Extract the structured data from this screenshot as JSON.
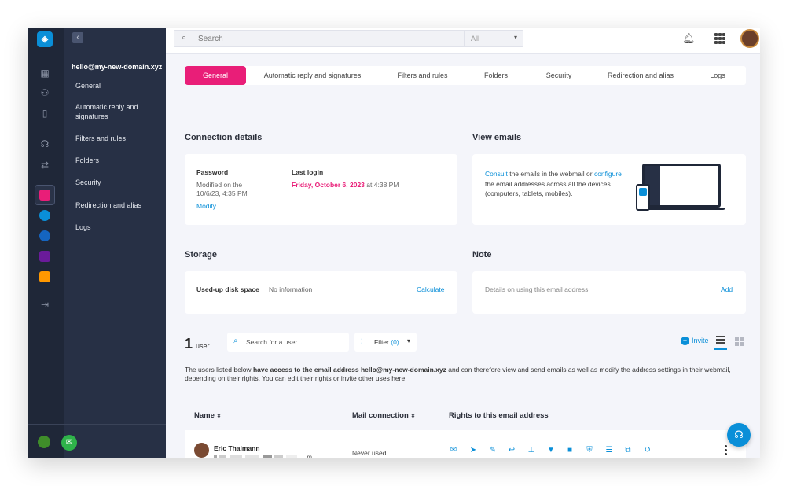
{
  "sidebar": {
    "account": "hello@my-new-domain.xyz",
    "items": [
      {
        "label": "General"
      },
      {
        "label": "Automatic reply and signatures"
      },
      {
        "label": "Filters and rules"
      },
      {
        "label": "Folders"
      },
      {
        "label": "Security"
      },
      {
        "label": "Redirection and alias"
      },
      {
        "label": "Logs"
      }
    ]
  },
  "topbar": {
    "search_placeholder": "Search",
    "scope_value": "All"
  },
  "tabs": [
    {
      "label": "General"
    },
    {
      "label": "Automatic reply and signatures"
    },
    {
      "label": "Filters and rules"
    },
    {
      "label": "Folders"
    },
    {
      "label": "Security"
    },
    {
      "label": "Redirection and alias"
    },
    {
      "label": "Logs"
    }
  ],
  "connection": {
    "title": "Connection details",
    "password_label": "Password",
    "modified_text": "Modified on the 10/6/23, 4:35 PM",
    "modify_link": "Modify",
    "last_login_label": "Last login",
    "last_login_date": "Friday, October 6, 2023",
    "last_login_time": "at 4:38 PM"
  },
  "view_emails": {
    "title": "View emails",
    "consult": "Consult",
    "text1": "the emails in the webmail or",
    "configure": "configure",
    "text2": "the email addresses across all the devices (computers, tablets, mobiles)."
  },
  "storage": {
    "title": "Storage",
    "label": "Used-up disk space",
    "value": "No information",
    "action": "Calculate"
  },
  "note": {
    "title": "Note",
    "placeholder": "Details on using this email address",
    "action": "Add"
  },
  "users": {
    "count": "1",
    "word": "user",
    "search_placeholder": "Search for a user",
    "filter_label": "Filter",
    "filter_count": "(0)",
    "invite": "Invite",
    "description_pre": "The users listed below ",
    "description_bold": "have access to the email address hello@my-new-domain.xyz",
    "description_post": " and can therefore view and send emails as well as modify the address settings in their webmail, depending on their rights. You can edit their rights or invite other uses here.",
    "columns": {
      "name": "Name",
      "connection": "Mail connection",
      "rights": "Rights to this email address"
    },
    "rows": [
      {
        "name": "Eric Thalmann",
        "email_end": "m",
        "connection": "Never used"
      }
    ]
  },
  "icons": {
    "app_colors": [
      "#e91e78",
      "#0a8fd8",
      "#1565c0",
      "#6a1b9a",
      "#ff9800"
    ],
    "accent": "#0a8fd8",
    "primary": "#e91e78"
  }
}
